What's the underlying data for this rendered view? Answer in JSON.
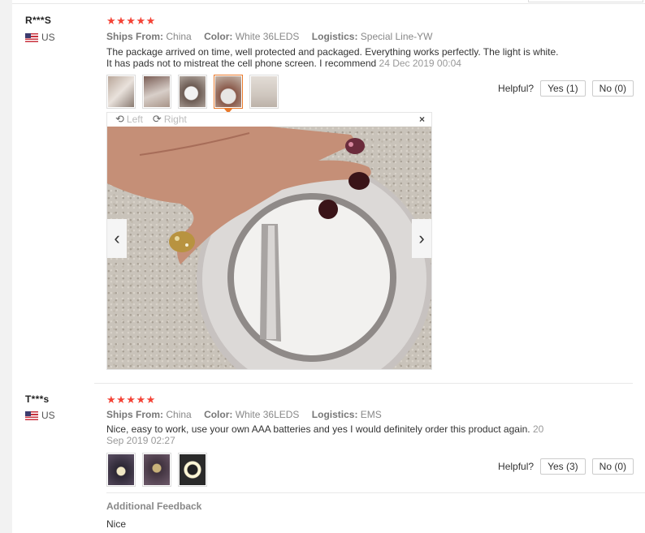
{
  "colors": {
    "star": "#f44336",
    "accent_border": "#e8792b",
    "meta_label": "#777777",
    "meta_value": "#888888"
  },
  "reviews": [
    {
      "user": "R***S",
      "country": "US",
      "stars": "★★★★★",
      "rating": 5,
      "ships_from_label": "Ships From:",
      "ships_from": "China",
      "color_label": "Color:",
      "color": "White 36LEDS",
      "logistics_label": "Logistics:",
      "logistics": "Special Line-YW",
      "comment": "The package arrived on time, well protected and packaged. Everything works perfectly. The light is white. It has pads not to mistreat the cell phone screen. I recommend",
      "date": "24 Dec 2019 00:04",
      "helpful_label": "Helpful?",
      "yes_label": "Yes (1)",
      "no_label": "No (0)",
      "thumbnails": 5,
      "viewer": {
        "left_label": "Left",
        "right_label": "Right",
        "close": "×",
        "prev": "‹",
        "next": "›"
      }
    },
    {
      "user": "T***s",
      "country": "US",
      "stars": "★★★★★",
      "rating": 5,
      "ships_from_label": "Ships From:",
      "ships_from": "China",
      "color_label": "Color:",
      "color": "White 36LEDS",
      "logistics_label": "Logistics:",
      "logistics": "EMS",
      "comment": "Nice, easy to work, use your own AAA batteries and yes I would definitely order this product again.",
      "date": "20 Sep 2019 02:27",
      "helpful_label": "Helpful?",
      "yes_label": "Yes (3)",
      "no_label": "No (0)",
      "thumbnails": 3,
      "additional_feedback_title": "Additional Feedback",
      "additional_feedback": "Nice"
    }
  ]
}
